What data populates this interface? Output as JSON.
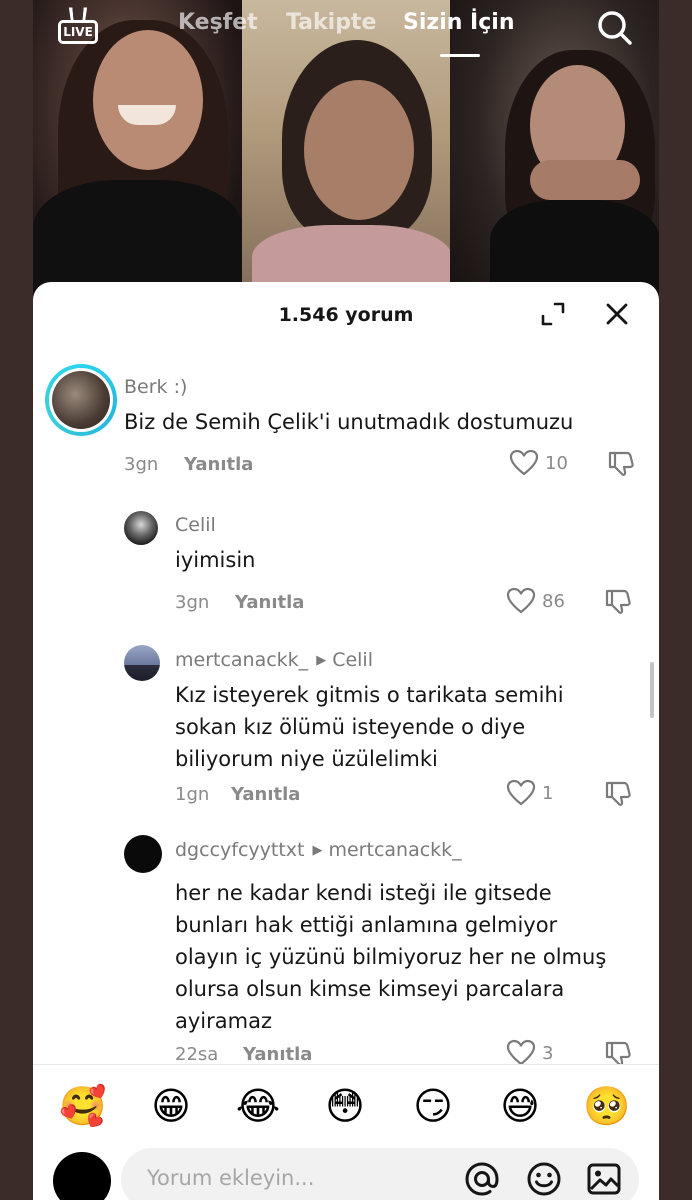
{
  "nav": {
    "live_label": "LIVE",
    "tabs": [
      {
        "label": "Keşfet"
      },
      {
        "label": "Takipte"
      },
      {
        "label": "Sizin İçin"
      }
    ]
  },
  "sheet": {
    "comment_count": "1.546 yorum"
  },
  "comments": [
    {
      "username": "Berk :)",
      "reply_to": "",
      "text": "Biz de Semih Çelik'i unutmadık dostumuzu",
      "time": "3gn",
      "reply_label": "Yanıtla",
      "likes": "10"
    },
    {
      "username": "Celil",
      "reply_to": "",
      "text": "iyimisin",
      "time": "3gn",
      "reply_label": "Yanıtla",
      "likes": "86"
    },
    {
      "username": "mertcanackk_",
      "reply_to": "Celil",
      "text": "Kız isteyerek gitmis o tarikata semihi sokan kız ölümü isteyende o diye biliyorum niye üzülelimki",
      "time": "1gn",
      "reply_label": "Yanıtla",
      "likes": "1"
    },
    {
      "username": "dgccyfcyyttxt",
      "reply_to": "mertcanackk_",
      "text": "her ne kadar kendi isteği ile gitsede bunları hak ettiği anlamına gelmiyor olayın iç yüzünü bilmiyoruz her ne olmuş olursa olsun kimse kimseyi parcalara ayiramaz",
      "time": "22sa",
      "reply_label": "Yanıtla",
      "likes": "3"
    }
  ],
  "emojis": [
    "🥰",
    "😁",
    "😂",
    "😳",
    "😏",
    "😅",
    "🥺"
  ],
  "composer": {
    "placeholder": "Yorum ekleyin..."
  },
  "icons": {
    "search": "search-icon",
    "expand": "expand-icon",
    "close": "close-icon",
    "heart": "heart-icon",
    "dislike": "thumbs-down-icon",
    "mention": "at-sign-icon",
    "emoji": "smiley-icon",
    "image": "image-icon"
  }
}
